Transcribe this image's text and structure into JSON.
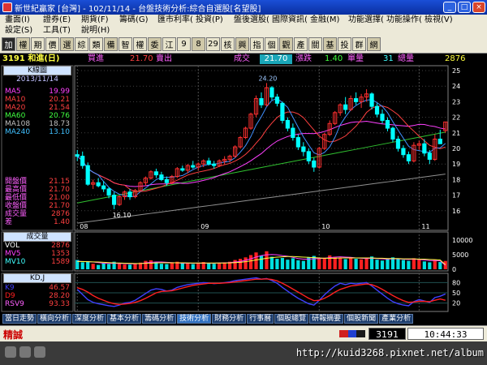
{
  "window": {
    "title": "新世紀贏家 [台灣] - 102/11/14 - 台盤技術分析:綜合自選股[名望股]"
  },
  "menu": [
    "畫面(I)",
    "證券(E)",
    "期貨(F)",
    "籌碼(G)",
    "匯市利率(R)",
    "投資(P)",
    "盤後選股(S)",
    "國際資訊(I)",
    "金融(M)",
    "功能選擇(X)",
    "功能操作(O)",
    "檢視(V)",
    "設定(S)",
    "工具(T)",
    "說明(H)"
  ],
  "toolbar": [
    "加",
    "權",
    "期",
    "價",
    "選",
    "綜",
    "類",
    "備",
    "智",
    "權",
    "委",
    "江",
    "9",
    "8",
    "29",
    "核",
    "興",
    "指",
    "個",
    "觀",
    "產",
    "關",
    "基",
    "投",
    "群",
    "網"
  ],
  "quote": {
    "code_name": "3191 和進(日)",
    "bid_label": "買進",
    "bid": "21.70",
    "ask_label": "賣出",
    "ask": "",
    "chg_label": "成交",
    "price": "21.70",
    "chg2_label": "漲跌",
    "chg": "1.40",
    "vol_label": "單量",
    "vol": "31",
    "tvol_label": "總量",
    "tvol": "2876"
  },
  "kpanel": {
    "header": "K線圖",
    "date": "2013/11/14",
    "ma": [
      {
        "name": "MA5",
        "value": "19.99",
        "color": "#ff40ff"
      },
      {
        "name": "MA10",
        "value": "20.21",
        "color": "#ff4040"
      },
      {
        "name": "MA20",
        "value": "21.54",
        "color": "#ff4040"
      },
      {
        "name": "MA60",
        "value": "20.76",
        "color": "#40ff40"
      },
      {
        "name": "MA108",
        "value": "18.73",
        "color": "#c0c0c0"
      },
      {
        "name": "MA240",
        "value": "13.10",
        "color": "#40c0ff"
      }
    ],
    "ohlc": [
      {
        "name": "開盤價",
        "value": "21.15"
      },
      {
        "name": "最高價",
        "value": "21.70"
      },
      {
        "name": "最低價",
        "value": "21.00"
      },
      {
        "name": "收盤價",
        "value": "21.70"
      },
      {
        "name": "成交量",
        "value": "2876"
      },
      {
        "name": "差",
        "value": "1.40"
      }
    ]
  },
  "volpanel": {
    "header": "成交量",
    "rows": [
      {
        "name": "VOL",
        "value": "2876"
      },
      {
        "name": "MV5",
        "value": "1353"
      },
      {
        "name": "MV10",
        "value": "1589"
      }
    ]
  },
  "kdpanel": {
    "header": "KD,J",
    "rows": [
      {
        "name": "K9",
        "value": "46.57"
      },
      {
        "name": "D9",
        "value": "28.20"
      },
      {
        "name": "RSV9",
        "value": "93.33"
      }
    ]
  },
  "chart_data": [
    {
      "type": "candlestick",
      "title": "K線圖",
      "x_months": [
        "08",
        "09",
        "10",
        "11"
      ],
      "ylim": [
        15,
        25
      ],
      "yticks": [
        16,
        17,
        18,
        19,
        20,
        21,
        22,
        23,
        24,
        25
      ],
      "max_label": "24.20",
      "min_label": "16.10",
      "candles": [
        [
          19.6,
          19.9,
          19.2,
          19.5
        ],
        [
          19.5,
          19.8,
          18.7,
          18.9
        ],
        [
          18.9,
          19.1,
          17.6,
          17.7
        ],
        [
          17.7,
          18.0,
          17.4,
          17.8
        ],
        [
          17.8,
          18.1,
          17.5,
          17.6
        ],
        [
          17.6,
          17.9,
          17.2,
          17.4
        ],
        [
          17.4,
          17.5,
          16.8,
          17.0
        ],
        [
          17.0,
          17.2,
          16.1,
          16.4
        ],
        [
          16.4,
          17.0,
          16.3,
          16.9
        ],
        [
          16.9,
          17.3,
          16.7,
          17.2
        ],
        [
          17.2,
          17.4,
          16.7,
          16.9
        ],
        [
          16.9,
          17.4,
          16.8,
          17.3
        ],
        [
          17.3,
          17.9,
          17.2,
          17.8
        ],
        [
          17.8,
          18.2,
          17.6,
          18.1
        ],
        [
          18.1,
          18.6,
          18.0,
          18.5
        ],
        [
          18.5,
          18.7,
          18.1,
          18.3
        ],
        [
          18.3,
          18.5,
          17.9,
          18.0
        ],
        [
          18.0,
          18.2,
          17.6,
          17.8
        ],
        [
          17.8,
          18.3,
          17.7,
          18.2
        ],
        [
          18.2,
          18.8,
          18.1,
          18.7
        ],
        [
          18.7,
          18.9,
          18.5,
          18.6
        ],
        [
          18.6,
          19.0,
          18.4,
          18.9
        ],
        [
          18.9,
          19.2,
          18.7,
          18.8
        ],
        [
          18.8,
          19.1,
          18.6,
          19.0
        ],
        [
          19.0,
          19.3,
          18.8,
          19.2
        ],
        [
          19.2,
          19.4,
          18.9,
          19.0
        ],
        [
          19.0,
          19.2,
          18.7,
          18.9
        ],
        [
          18.9,
          19.3,
          18.8,
          19.2
        ],
        [
          19.2,
          19.5,
          19.0,
          19.3
        ],
        [
          19.3,
          19.6,
          19.1,
          19.5
        ],
        [
          19.5,
          20.2,
          19.4,
          20.1
        ],
        [
          20.1,
          20.8,
          20.0,
          20.7
        ],
        [
          20.7,
          21.4,
          20.6,
          21.3
        ],
        [
          21.3,
          22.3,
          21.2,
          22.2
        ],
        [
          22.2,
          23.4,
          22.0,
          23.2
        ],
        [
          23.2,
          23.6,
          22.6,
          22.8
        ],
        [
          22.8,
          24.2,
          22.7,
          23.9
        ],
        [
          23.9,
          24.0,
          23.1,
          23.3
        ],
        [
          23.3,
          23.5,
          22.7,
          22.9
        ],
        [
          22.9,
          23.0,
          21.6,
          21.8
        ],
        [
          21.8,
          22.0,
          21.1,
          21.3
        ],
        [
          21.3,
          21.6,
          20.5,
          20.7
        ],
        [
          20.7,
          20.9,
          19.9,
          20.1
        ],
        [
          20.1,
          20.4,
          19.5,
          19.8
        ],
        [
          19.8,
          20.0,
          19.0,
          19.2
        ],
        [
          19.2,
          19.4,
          18.5,
          18.8
        ],
        [
          18.8,
          20.1,
          18.7,
          20.0
        ],
        [
          20.0,
          21.0,
          19.9,
          20.9
        ],
        [
          20.9,
          21.8,
          20.8,
          21.6
        ],
        [
          21.6,
          22.4,
          21.5,
          22.3
        ],
        [
          22.3,
          22.9,
          22.1,
          22.8
        ],
        [
          22.8,
          23.3,
          22.2,
          22.5
        ],
        [
          22.5,
          23.4,
          22.4,
          23.2
        ],
        [
          23.2,
          23.6,
          22.8,
          23.0
        ],
        [
          23.0,
          23.5,
          22.6,
          23.3
        ],
        [
          23.3,
          23.8,
          23.0,
          23.5
        ],
        [
          23.5,
          23.6,
          22.5,
          22.7
        ],
        [
          22.7,
          22.9,
          22.0,
          22.2
        ],
        [
          22.2,
          22.5,
          21.6,
          21.8
        ],
        [
          21.8,
          22.0,
          21.1,
          21.3
        ],
        [
          21.3,
          21.4,
          20.4,
          20.6
        ],
        [
          20.6,
          20.8,
          19.8,
          20.0
        ],
        [
          20.0,
          20.2,
          19.4,
          19.6
        ],
        [
          19.6,
          19.8,
          19.0,
          19.2
        ],
        [
          19.2,
          20.4,
          19.1,
          20.2
        ],
        [
          20.2,
          20.5,
          19.9,
          20.3
        ],
        [
          20.3,
          20.6,
          19.5,
          19.7
        ],
        [
          19.7,
          19.9,
          19.0,
          19.3
        ],
        [
          19.3,
          20.9,
          19.2,
          20.6
        ],
        [
          20.6,
          21.2,
          20.3,
          20.3
        ],
        [
          21.15,
          21.7,
          21.0,
          21.7
        ]
      ]
    },
    {
      "type": "bar",
      "title": "成交量",
      "ylim": [
        0,
        12000
      ],
      "yticks": [
        0,
        5000,
        10000
      ],
      "values": [
        3200,
        2400,
        2800,
        1900,
        1500,
        2100,
        1800,
        2600,
        2200,
        1700,
        1600,
        2000,
        2300,
        2900,
        3100,
        2400,
        1900,
        1800,
        2100,
        2600,
        2200,
        2000,
        1800,
        2300,
        2500,
        2100,
        1900,
        2200,
        2400,
        2600,
        3200,
        3600,
        4100,
        4900,
        5800,
        4700,
        6200,
        4300,
        3600,
        3900,
        3300,
        3800,
        3100,
        2900,
        4200,
        4600,
        3700,
        4000,
        4800,
        4300,
        3900,
        3500,
        4100,
        3600,
        3400,
        3700,
        4400,
        3300,
        3000,
        3500,
        4100,
        3600,
        3200,
        2900,
        3800,
        3300,
        2700,
        2400,
        3300,
        2500,
        2876
      ],
      "mv5": [
        2800,
        2700,
        2600,
        2500,
        2300,
        2100,
        2000,
        2100,
        2000,
        2000,
        1900,
        1900,
        2000,
        2200,
        2400,
        2500,
        2500,
        2400,
        2300,
        2200,
        2100,
        2100,
        2100,
        2100,
        2100,
        2100,
        2100,
        2200,
        2200,
        2300,
        2500,
        2700,
        3100,
        3600,
        4200,
        4700,
        5000,
        5100,
        5000,
        4700,
        4500,
        4100,
        3700,
        3500,
        3500,
        3600,
        3700,
        3800,
        4000,
        4200,
        4300,
        4200,
        4100,
        3900,
        3800,
        3700,
        3800,
        3700,
        3600,
        3500,
        3600,
        3600,
        3500,
        3400,
        3500,
        3400,
        3200,
        3000,
        3000,
        2900,
        1353
      ],
      "mv10": [
        2700,
        2650,
        2600,
        2550,
        2500,
        2400,
        2300,
        2200,
        2150,
        2100,
        2050,
        2000,
        2000,
        2050,
        2100,
        2200,
        2250,
        2250,
        2250,
        2250,
        2250,
        2200,
        2150,
        2150,
        2150,
        2150,
        2150,
        2150,
        2150,
        2200,
        2300,
        2400,
        2600,
        2900,
        3200,
        3500,
        3800,
        4000,
        4200,
        4300,
        4400,
        4400,
        4300,
        4200,
        4100,
        4000,
        3900,
        3800,
        3800,
        3800,
        3900,
        3900,
        3900,
        3900,
        3900,
        3900,
        3900,
        3800,
        3800,
        3700,
        3700,
        3700,
        3600,
        3600,
        3600,
        3500,
        3500,
        3400,
        3300,
        3200,
        1589
      ]
    },
    {
      "type": "line",
      "title": "KD,J",
      "ylim": [
        0,
        100
      ],
      "yticks": [
        20,
        50,
        80
      ],
      "series": [
        {
          "name": "K9",
          "color": "#4040ff",
          "values": [
            60,
            45,
            30,
            22,
            18,
            15,
            12,
            10,
            14,
            20,
            22,
            28,
            38,
            48,
            58,
            62,
            60,
            55,
            58,
            66,
            70,
            74,
            76,
            78,
            80,
            79,
            77,
            78,
            80,
            82,
            86,
            88,
            90,
            92,
            94,
            90,
            92,
            86,
            78,
            66,
            55,
            44,
            34,
            26,
            18,
            14,
            28,
            44,
            58,
            70,
            78,
            74,
            78,
            76,
            78,
            80,
            70,
            58,
            46,
            34,
            24,
            18,
            14,
            12,
            24,
            30,
            26,
            22,
            36,
            40,
            46.57
          ]
        },
        {
          "name": "D9",
          "color": "#ff2020",
          "values": [
            65,
            60,
            52,
            42,
            34,
            28,
            22,
            18,
            16,
            17,
            19,
            22,
            27,
            34,
            42,
            50,
            54,
            55,
            56,
            60,
            64,
            68,
            72,
            74,
            76,
            78,
            78,
            78,
            79,
            80,
            82,
            84,
            86,
            88,
            90,
            90,
            91,
            89,
            85,
            78,
            70,
            61,
            52,
            43,
            34,
            27,
            28,
            34,
            42,
            52,
            60,
            65,
            70,
            72,
            74,
            76,
            74,
            68,
            60,
            51,
            42,
            34,
            27,
            22,
            23,
            25,
            25,
            24,
            28,
            32,
            28.2
          ]
        }
      ]
    }
  ],
  "tabs": [
    "當日走勢",
    "橫向分析",
    "深度分析",
    "基本分析",
    "籌碼分析",
    "技術分析",
    "財務分析",
    "行事曆",
    "個股總覽",
    "研報摘要",
    "個股新聞",
    "產業分析"
  ],
  "active_tab": "技術分析",
  "status": {
    "left": "精誠",
    "code": "3191",
    "time": "10:44:33"
  },
  "watermark_url": "http://kuid3268.pixnet.net/album",
  "colors": {
    "up": "#ff3030",
    "down": "#00ffff",
    "grid": "#404040",
    "axis": "#ffffff"
  }
}
